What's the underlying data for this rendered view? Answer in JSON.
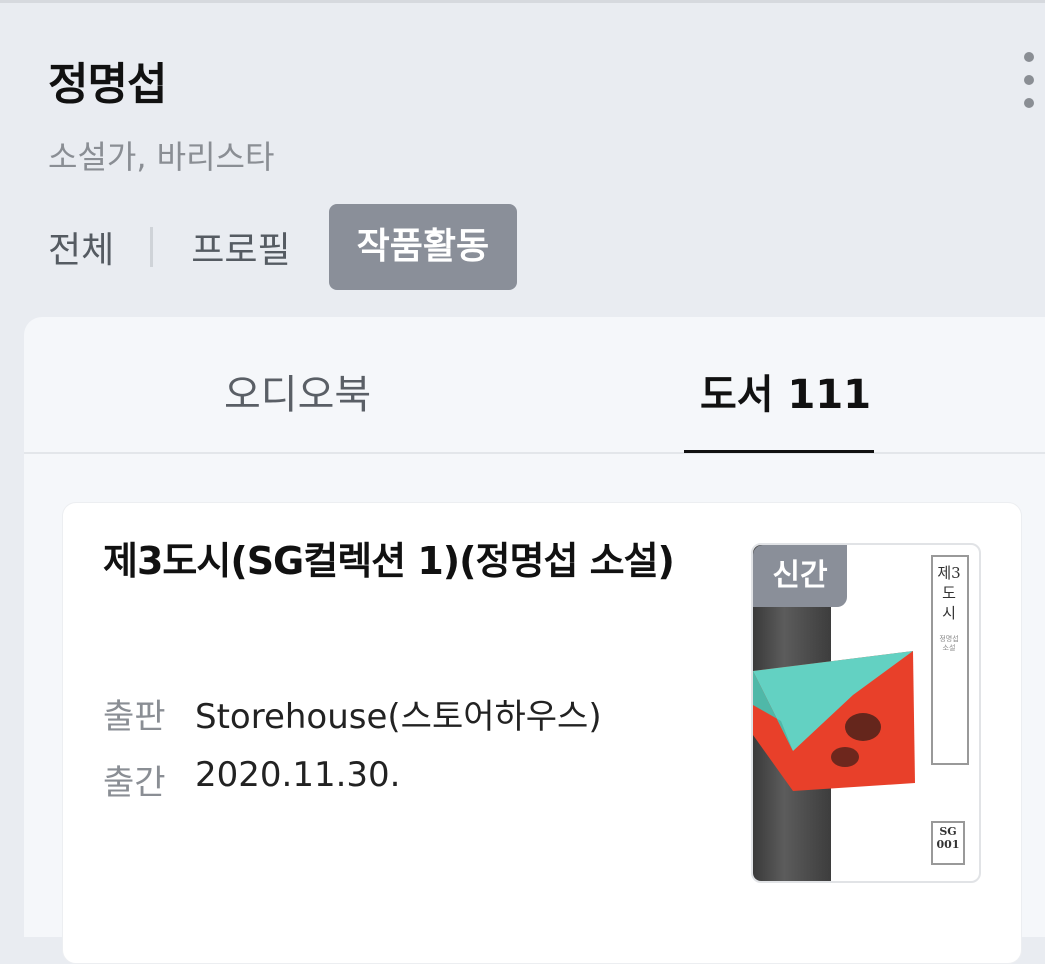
{
  "author": {
    "name": "정명섭",
    "roles": "소설가, 바리스타"
  },
  "tabs": [
    "전체",
    "프로필",
    "작품활동"
  ],
  "subtabs": {
    "audio": "오디오북",
    "books": "도서 111"
  },
  "book": {
    "title": "제3도시(SG컬렉션 1)(정명섭 소설)",
    "publisher_label": "출판",
    "publisher": "Storehouse(스토어하우스)",
    "date_label": "출간",
    "date": "2020.11.30.",
    "badge": "신간",
    "cover_title": "제3도시",
    "cover_author": "정명섭 소설",
    "cover_mark": "SG 001"
  },
  "icons": {
    "more": "more-vertical-icon"
  },
  "colors": {
    "background": "#e9ecf1",
    "active_tab": "#8a8f99",
    "panel": "#f5f7fa"
  }
}
